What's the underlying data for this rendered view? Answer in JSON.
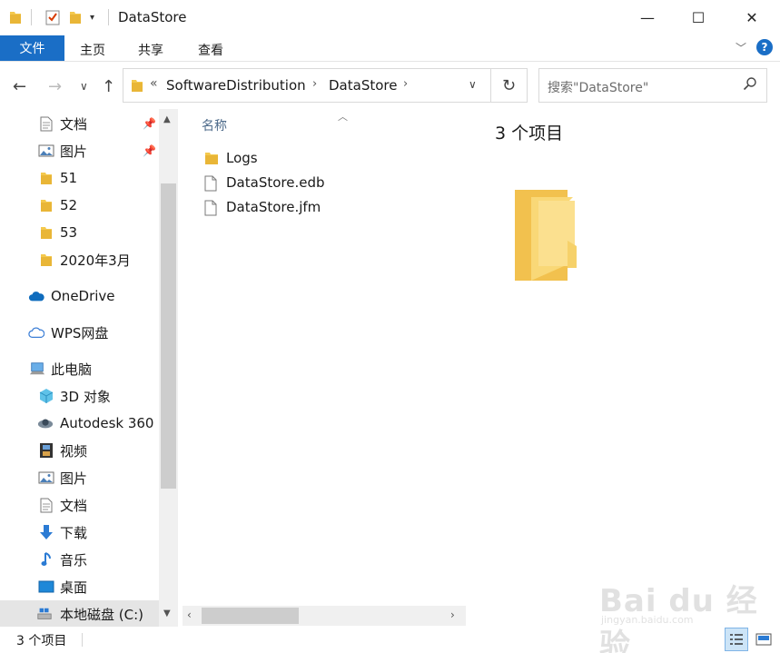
{
  "window": {
    "title": "DataStore",
    "controls": {
      "minimize": "—",
      "maximize": "☐",
      "close": "✕"
    }
  },
  "ribbon": {
    "tabs": [
      "文件",
      "主页",
      "共享",
      "查看"
    ],
    "help": "?"
  },
  "address": {
    "laquo": "«",
    "crumbs": [
      "SoftwareDistribution",
      "DataStore"
    ],
    "separator": "›"
  },
  "search": {
    "placeholder": "搜索\"DataStore\""
  },
  "sidebar": {
    "items": [
      {
        "label": "文档",
        "icon": "document-icon",
        "pinned": true
      },
      {
        "label": "图片",
        "icon": "picture-icon",
        "pinned": true
      },
      {
        "label": "51",
        "icon": "folder-icon"
      },
      {
        "label": "52",
        "icon": "folder-icon"
      },
      {
        "label": "53",
        "icon": "folder-icon"
      },
      {
        "label": "2020年3月",
        "icon": "folder-icon"
      },
      {
        "label": "OneDrive",
        "icon": "cloud-icon"
      },
      {
        "label": "WPS网盘",
        "icon": "cloud-outline-icon"
      },
      {
        "label": "此电脑",
        "icon": "computer-icon"
      },
      {
        "label": "3D 对象",
        "icon": "cube-icon"
      },
      {
        "label": "Autodesk 360",
        "icon": "autodesk-icon"
      },
      {
        "label": "视频",
        "icon": "film-icon"
      },
      {
        "label": "图片",
        "icon": "picture-icon"
      },
      {
        "label": "文档",
        "icon": "document-icon"
      },
      {
        "label": "下载",
        "icon": "download-arrow-icon"
      },
      {
        "label": "音乐",
        "icon": "music-note-icon"
      },
      {
        "label": "桌面",
        "icon": "desktop-icon"
      },
      {
        "label": "本地磁盘 (C:)",
        "icon": "drive-icon",
        "selected": true
      }
    ]
  },
  "files": {
    "column_header": "名称",
    "items": [
      {
        "name": "Logs",
        "type": "folder"
      },
      {
        "name": "DataStore.edb",
        "type": "file"
      },
      {
        "name": "DataStore.jfm",
        "type": "file"
      }
    ]
  },
  "preview": {
    "count": "3 个项目"
  },
  "status": {
    "count": "3 个项目"
  },
  "watermark": {
    "brand": "Bai du 经验",
    "url": "jingyan.baidu.com"
  },
  "colors": {
    "accent": "#1a6ec6",
    "folder": "#f4c94e",
    "selected": "#e5e5e5"
  }
}
